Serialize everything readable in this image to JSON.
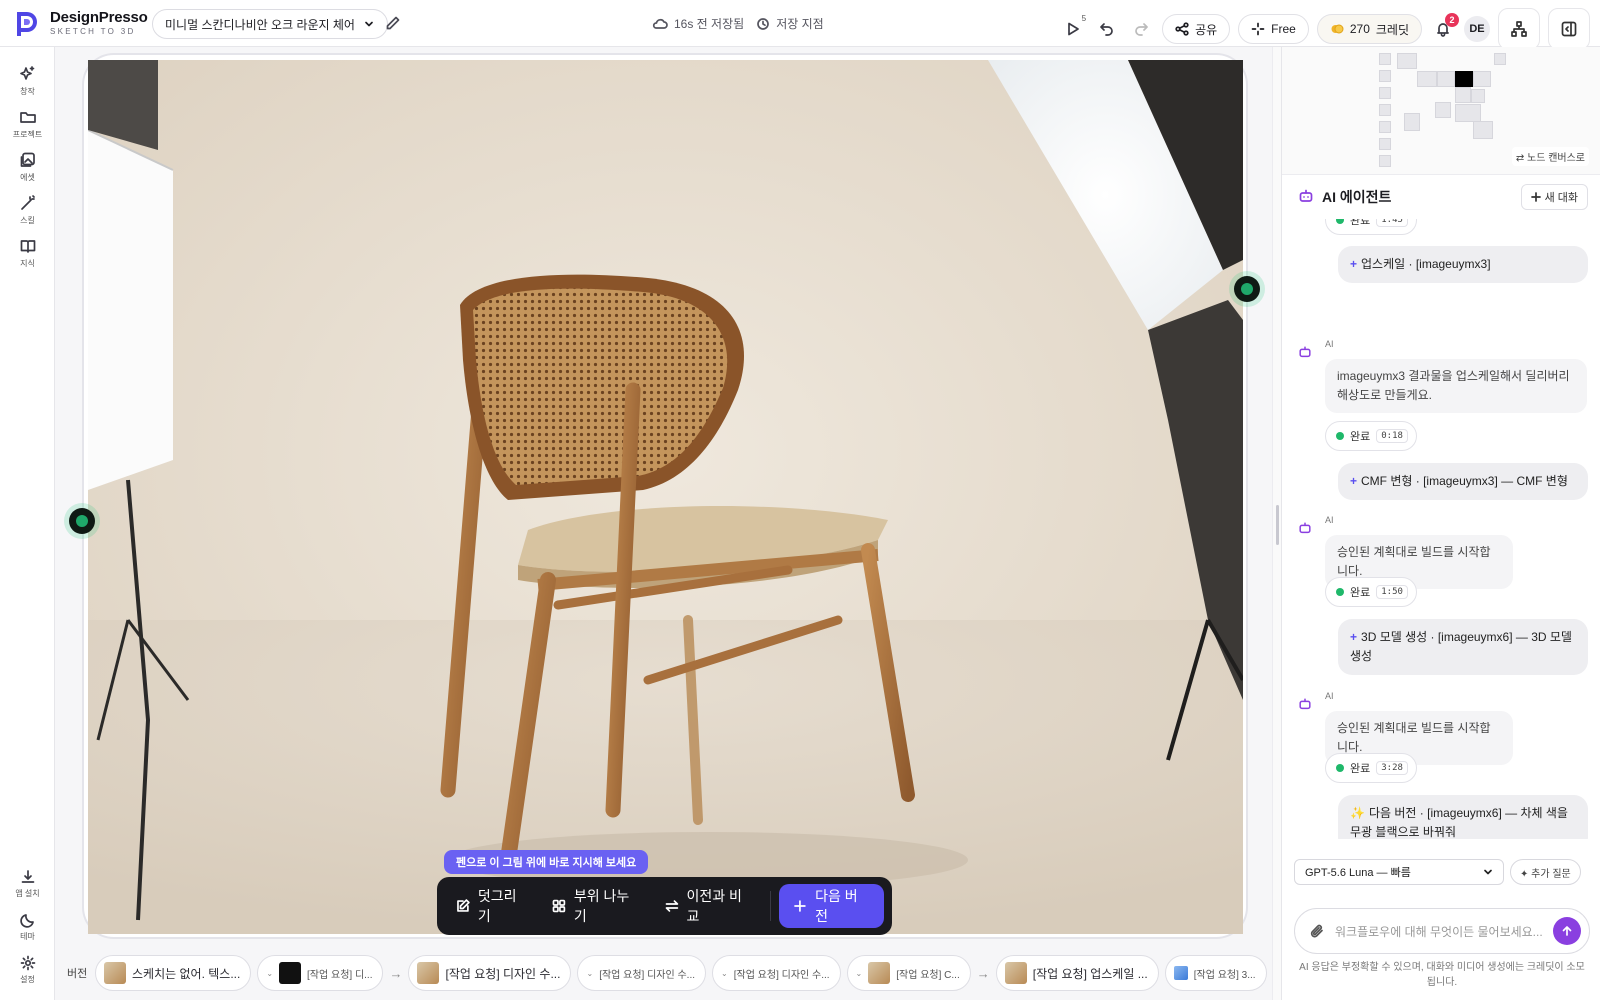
{
  "brand": {
    "name": "DesignPresso",
    "tagline": "SKETCH TO 3D",
    "accent": "#5a4ff0"
  },
  "project": {
    "title": "미니멀 스칸디나비안 오크 라운지 체어"
  },
  "save": {
    "status": "16s 전 저장됨",
    "savepoint": "저장 지점"
  },
  "toolbar_top": {
    "play_count": "5",
    "share": "공유",
    "plan": "Free",
    "credits": "270",
    "credits_label": "크레딧",
    "notifications": "2",
    "user_initials": "DE"
  },
  "sidebar": {
    "items": [
      {
        "label": "창작",
        "icon": "sparkle-icon"
      },
      {
        "label": "프로젝트",
        "icon": "folder-icon"
      },
      {
        "label": "에셋",
        "icon": "images-icon"
      },
      {
        "label": "스킬",
        "icon": "wand-icon"
      },
      {
        "label": "지식",
        "icon": "book-icon"
      }
    ],
    "bottom": [
      {
        "label": "앱 설치",
        "icon": "download-icon"
      },
      {
        "label": "테마",
        "icon": "moon-icon"
      },
      {
        "label": "설정",
        "icon": "gear-icon"
      }
    ]
  },
  "canvas": {
    "hint": "펜으로 이 그림 위에 바로 지시해 보세요",
    "tools": {
      "draw": "덧그리기",
      "split": "부위 나누기",
      "compare": "이전과 비교",
      "next": "다음 버전"
    }
  },
  "versions": {
    "label": "버전",
    "items": [
      "스케치는 없어. 텍스...",
      "[작업 요청] 디...",
      "[작업 요청] 디자인 수...",
      "[작업 요청] 디자인 수...",
      "[작업 요청] 디자인 수...",
      "[작업 요청] C...",
      "[작업 요청] 업스케일 ...",
      "[작업 요청] 3..."
    ]
  },
  "panel": {
    "node_canvas": "노드 캔버스로",
    "agent_title": "AI 에이전트",
    "new_chat": "새 대화",
    "messages": {
      "top_status": "완료",
      "top_status_time": "1:45",
      "req1": "업스케일 · [imageuymx3]",
      "ai_label": "AI",
      "ai1": "imageuymx3 결과물을 업스케일해서 딜리버리 해상도로 만들게요.",
      "st1": "완료",
      "st1_time": "0:18",
      "req2": "CMF 변형 · [imageuymx3] — CMF 변형",
      "ai2": "승인된 계획대로 빌드를 시작합니다.",
      "st2": "완료",
      "st2_time": "1:50",
      "req3": "3D 모델 생성 · [imageuymx6] — 3D 모델 생성",
      "ai3": "승인된 계획대로 빌드를 시작합니다.",
      "st3": "완료",
      "st3_time": "3:28",
      "req4": "다음 버전 · [imageuymx6] — 차체 색을 무광 블랙으로 바꿔줘"
    },
    "model": "GPT-5.6 Luna — 빠름",
    "add_question": "✦ 추가 질문",
    "composer_placeholder": "워크플로우에 대해 무엇이든 물어보세요...",
    "disclaimer": "AI 응답은 부정확할 수 있으며, 대화와 미디어 생성에는 크레딧이 소모됩니다."
  }
}
